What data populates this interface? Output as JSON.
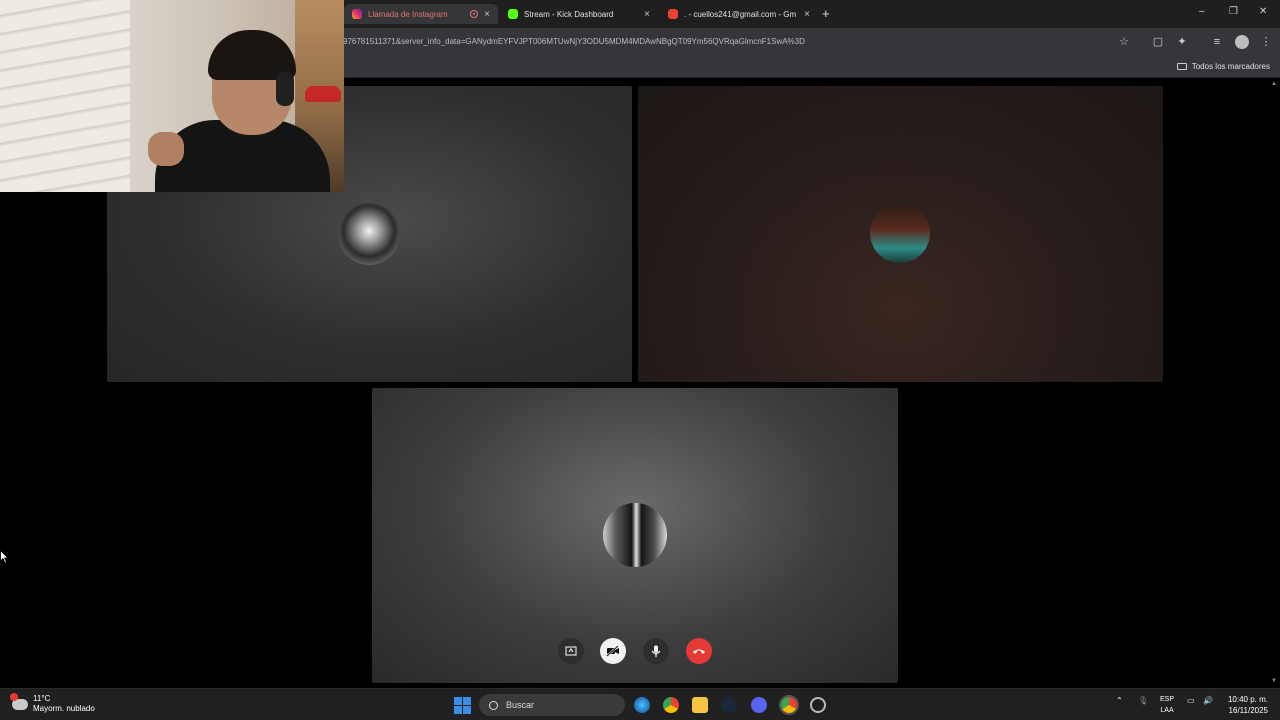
{
  "browser": {
    "tabs": [
      {
        "title": "Llamada de Instagram",
        "active": true,
        "color": "#e1306c"
      },
      {
        "title": "Stream - Kick Dashboard",
        "active": false,
        "color": "#53fc18"
      },
      {
        "title": ". - cuellos241@gmail.com - Gm",
        "active": false,
        "color": "#ea4335"
      }
    ],
    "url": "976781511371&server_info_data=GANydmEYFVJPT006MTUwNjY3ODU5MDM4MDAwNBgQT09Ym56QVRqaGlmcnF1SwA%3D",
    "bookmarks_label": "Todos los marcadores"
  },
  "call": {
    "participants": [
      {
        "avatar": "participant-avatar-1"
      },
      {
        "avatar": "participant-avatar-2"
      },
      {
        "avatar": "participant-avatar-3"
      }
    ],
    "controls": [
      "share-screen-button",
      "camera-off-button",
      "microphone-button",
      "end-call-button"
    ]
  },
  "taskbar": {
    "weather_temp": "11°C",
    "weather_desc": "Mayorm. nublado",
    "search_placeholder": "Buscar",
    "lang_top": "ESP",
    "lang_bottom": "LAA",
    "time": "10:40 p. m.",
    "date": "16/11/2025"
  },
  "colors": {
    "end_call": "#e53935",
    "chrome_bg": "#35363a",
    "taskbar_bg": "#202020"
  }
}
